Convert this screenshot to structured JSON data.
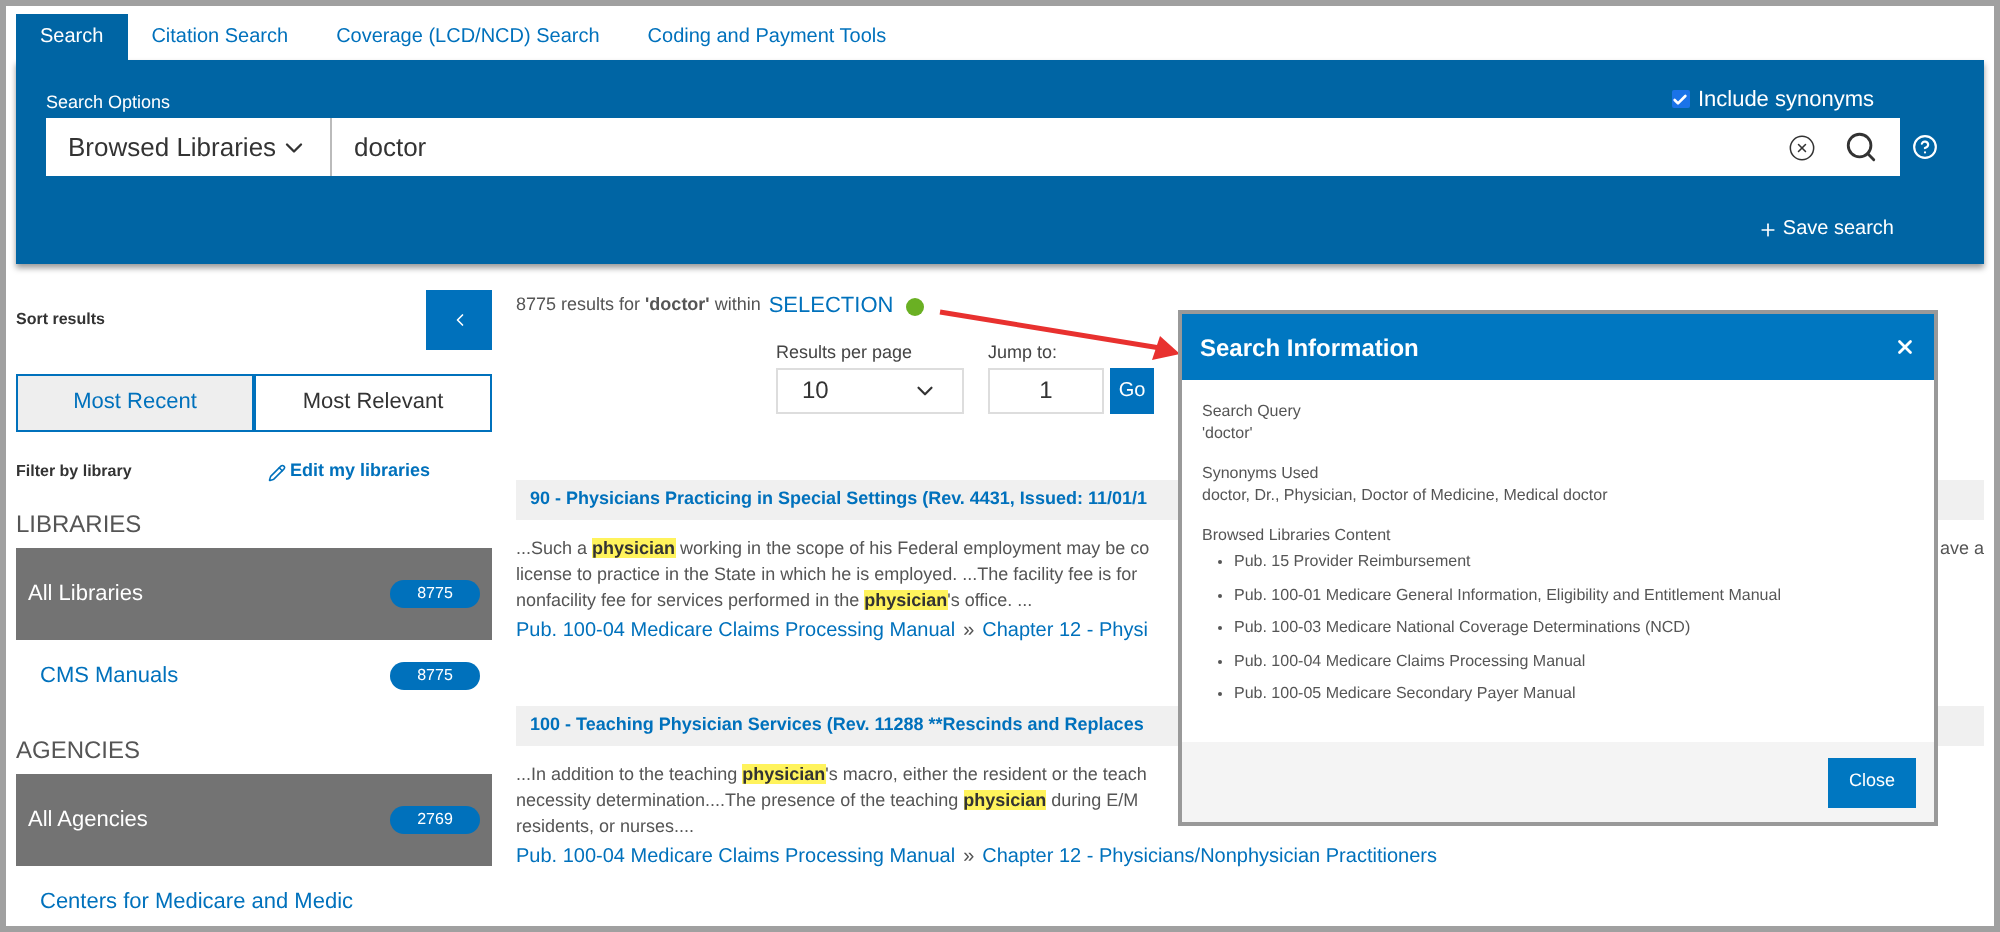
{
  "tabs": [
    {
      "label": "Search",
      "selected": true
    },
    {
      "label": "Citation Search",
      "selected": false
    },
    {
      "label": "Coverage (LCD/NCD) Search",
      "selected": false
    },
    {
      "label": "Coding and Payment Tools",
      "selected": false
    }
  ],
  "search_panel": {
    "label": "Search Options",
    "include_synonyms": {
      "label": "Include synonyms",
      "checked": true
    },
    "scope": "Browsed Libraries",
    "query": "doctor",
    "save_search": "Save search"
  },
  "sidebar": {
    "sort_label": "Sort results",
    "sort_options": [
      {
        "label": "Most Recent",
        "selected": true
      },
      {
        "label": "Most Relevant",
        "selected": false
      }
    ],
    "filter_label": "Filter by library",
    "edit_link": "Edit my libraries",
    "groups": [
      {
        "heading": "LIBRARIES",
        "items": [
          {
            "label": "All Libraries",
            "count": "8775",
            "selected": true
          },
          {
            "label": "CMS Manuals",
            "count": "8775",
            "selected": false
          }
        ]
      },
      {
        "heading": "AGENCIES",
        "items": [
          {
            "label": "All Agencies",
            "count": "2769",
            "selected": true
          },
          {
            "label": "Centers for Medicare and Medic",
            "selected": false
          }
        ]
      }
    ]
  },
  "results_summary": {
    "text": "8775 results for **'doctor'** within",
    "link": "SELECTION"
  },
  "pagination": {
    "per_page_label": "Results per page",
    "per_page_value": "10",
    "jump_label": "Jump to:",
    "jump_value": "1",
    "go": "Go"
  },
  "results": [
    {
      "title": "90 - Physicians Practicing in Special Settings (Rev. 4431, Issued: 11/01/1",
      "snippet": [
        {
          "text": "...Such a **physician** working in the scope of his Federal employment may be co",
          "right": "ave a"
        },
        {
          "text": "license to practice in the State in which he is employed. ...The facility fee is for"
        },
        {
          "text": "nonfacility fee for services performed in the **physician**'s office. ..."
        }
      ],
      "path_separator": "»",
      "path": [
        "Pub. 100-04 Medicare Claims Processing Manual",
        "Chapter 12 - Physi"
      ]
    },
    {
      "title": "100 - Teaching Physician Services (Rev. 11288 **Rescinds and Replaces",
      "snippet": [
        {
          "text": "...In addition to the teaching **physician**'s macro, either the resident or the teach"
        },
        {
          "text": "necessity determination....The presence of the teaching **physician** during E/M"
        },
        {
          "text": "residents, or nurses...."
        }
      ],
      "path_separator": "»",
      "path": [
        "Pub. 100-04 Medicare Claims Processing Manual",
        "Chapter 12 - Physicians/Nonphysician Practitioners"
      ]
    }
  ],
  "modal": {
    "title": "Search Information",
    "sections": [
      {
        "heading": "Search Query",
        "text": "'doctor'"
      },
      {
        "heading": "Synonyms Used",
        "text": "doctor, Dr., Physician, Doctor of Medicine, Medical doctor"
      },
      {
        "heading": "Browsed Libraries Content",
        "items": [
          "Pub. 15 Provider Reimbursement",
          "Pub. 100-01 Medicare General Information, Eligibility and Entitlement Manual",
          "Pub. 100-03 Medicare National Coverage Determinations (NCD)",
          "Pub. 100-04 Medicare Claims Processing Manual",
          "Pub. 100-05 Medicare Secondary Payer Manual"
        ]
      }
    ],
    "close": "Close"
  }
}
